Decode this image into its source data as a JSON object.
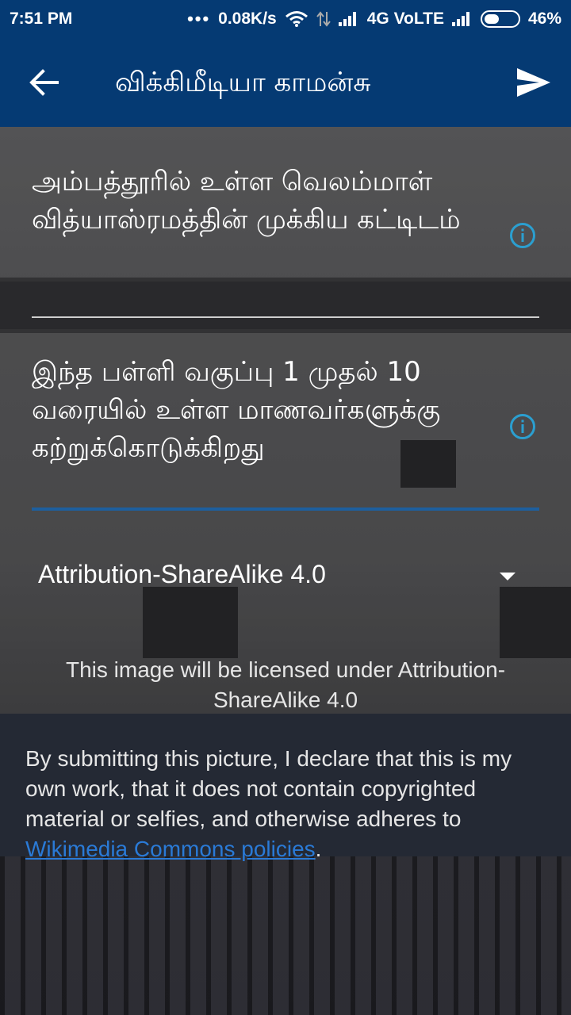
{
  "status_bar": {
    "time": "7:51 PM",
    "dots": "•••",
    "speed": "0.08K/s",
    "network": "4G VoLTE",
    "battery": "46%",
    "battery_level": 0.46,
    "icons": [
      "wifi-icon",
      "data-arrows-icon",
      "signal-icon",
      "signal-icon-2",
      "battery-icon"
    ]
  },
  "app_bar": {
    "title": "விக்கிமீடியா காமன்சு",
    "back_icon": "arrow-back-icon",
    "send_icon": "send-icon"
  },
  "title_field": {
    "value": "அம்பத்தூரில் உள்ள வெலம்மாள் வித்யாஸ்ரமத்தின் முக்கிய கட்டிடம்",
    "info_icon": "info-icon"
  },
  "description_field": {
    "value": "இந்த பள்ளி வகுப்பு 1 முதல் 10 வரையில் உள்ள மாணவர்களுக்கு கற்றுக்கொடுக்கிறது",
    "info_icon": "info-icon"
  },
  "license": {
    "selected": "Attribution-ShareAlike 4.0",
    "note": "This image will be licensed under Attribution-ShareAlike 4.0"
  },
  "declaration": {
    "text": "By submitting this picture, I declare that this is my own work, that it does not contain copyrighted material or selfies, and otherwise adheres to ",
    "link": "Wikimedia Commons policies",
    "suffix": "."
  },
  "colors": {
    "app_bar": "#053a73",
    "link": "#2a7ad6",
    "info_icon": "#2b9fd0",
    "active_underline": "#1d5f9e"
  }
}
